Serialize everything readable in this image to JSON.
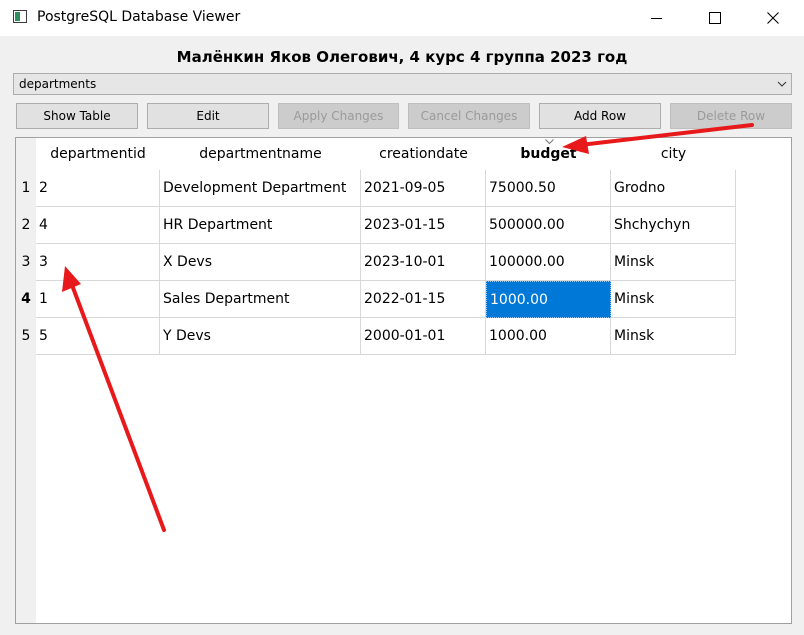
{
  "window": {
    "title": "PostgreSQL Database Viewer",
    "controls": [
      "minimize",
      "maximize",
      "close"
    ]
  },
  "heading": "Малёнкин Яков Олегович, 4 курс 4 группа 2023 год",
  "table_selector": {
    "value": "departments"
  },
  "toolbar": {
    "buttons": [
      {
        "label": "Show Table",
        "enabled": true
      },
      {
        "label": "Edit",
        "enabled": true
      },
      {
        "label": "Apply Changes",
        "enabled": false
      },
      {
        "label": "Cancel Changes",
        "enabled": false
      },
      {
        "label": "Add Row",
        "enabled": true
      },
      {
        "label": "Delete Row",
        "enabled": false
      }
    ]
  },
  "table": {
    "columns": [
      "departmentid",
      "departmentname",
      "creationdate",
      "budget",
      "city"
    ],
    "sorted_column": "budget",
    "row_numbers": [
      "1",
      "2",
      "3",
      "4",
      "5"
    ],
    "current_row": "4",
    "rows": [
      [
        "2",
        "Development Department",
        "2021-09-05",
        "75000.50",
        "Grodno"
      ],
      [
        "4",
        "HR Department",
        "2023-01-15",
        "500000.00",
        "Shchychyn"
      ],
      [
        "3",
        "X Devs",
        "2023-10-01",
        "100000.00",
        "Minsk"
      ],
      [
        "1",
        "Sales Department",
        "2022-01-15",
        "1000.00",
        "Minsk"
      ],
      [
        "5",
        "Y Devs",
        "2000-01-01",
        "1000.00",
        "Minsk"
      ]
    ],
    "selected_cell": {
      "row": 4,
      "column": "budget"
    }
  },
  "colors": {
    "selection": "#0078d7",
    "annotation_arrow": "#e8191b"
  }
}
